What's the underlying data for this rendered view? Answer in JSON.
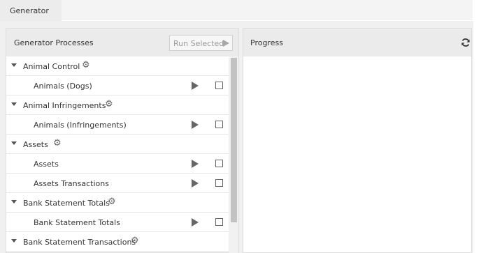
{
  "tabs": [
    {
      "label": "Generator"
    }
  ],
  "left_panel": {
    "title": "Generator Processes",
    "run_selected_label": "Run Selected",
    "rows": [
      {
        "kind": "group",
        "label": "Animal Control"
      },
      {
        "kind": "child",
        "label": "Animals (Dogs)"
      },
      {
        "kind": "group",
        "label": "Animal Infringements"
      },
      {
        "kind": "child",
        "label": "Animals (Infringements)"
      },
      {
        "kind": "group",
        "label": "Assets"
      },
      {
        "kind": "child",
        "label": "Assets"
      },
      {
        "kind": "child",
        "label": "Assets Transactions"
      },
      {
        "kind": "group",
        "label": "Bank Statement Totals"
      },
      {
        "kind": "child",
        "label": "Bank Statement Totals"
      },
      {
        "kind": "group",
        "label": "Bank Statement Transactions"
      }
    ]
  },
  "right_panel": {
    "title": "Progress"
  },
  "icons": {
    "expand": "caret-down-icon",
    "settings": "gear-icon",
    "run": "play-icon",
    "select": "checkbox",
    "refresh": "refresh-icon"
  }
}
